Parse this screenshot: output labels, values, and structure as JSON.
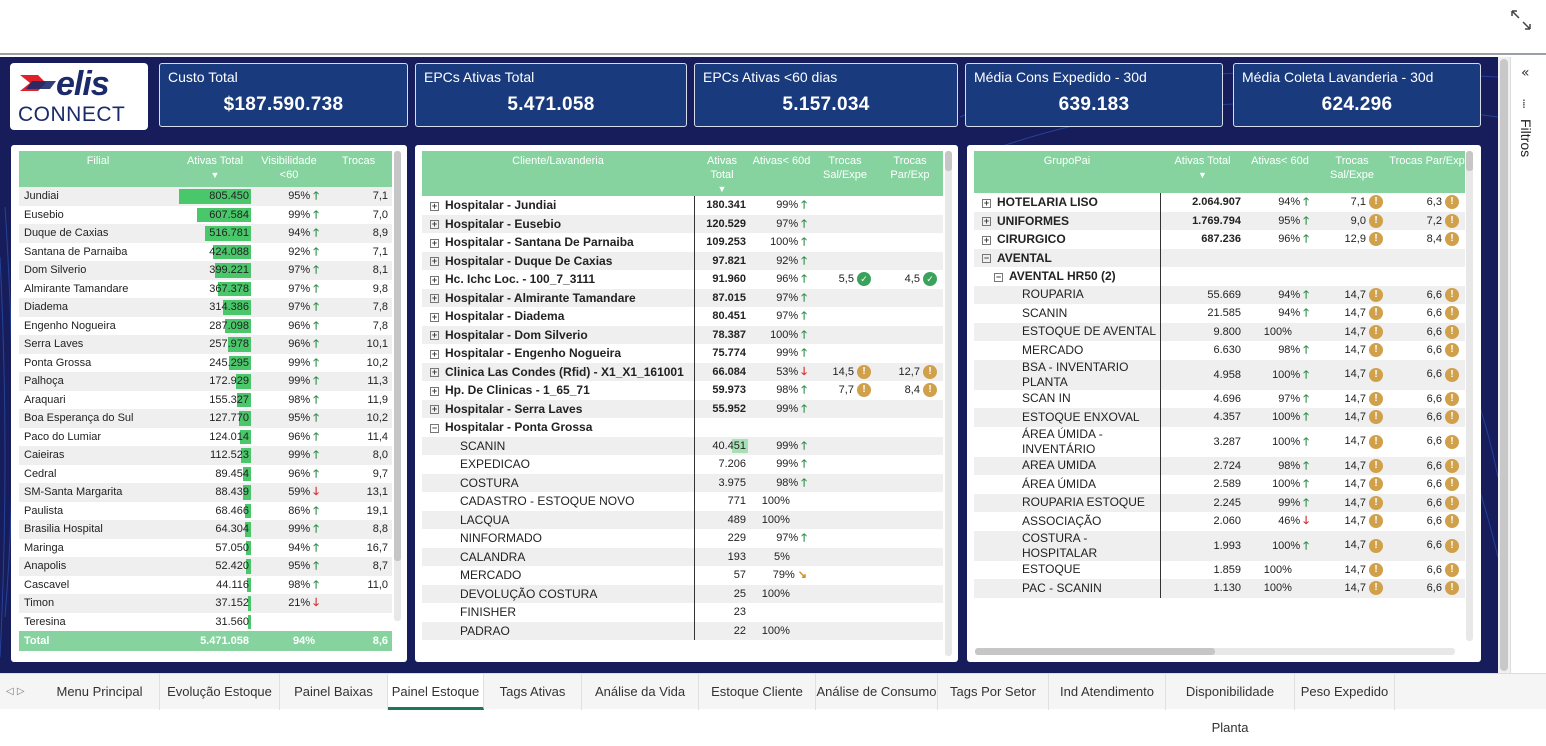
{
  "kpis": [
    {
      "title": "Custo Total",
      "value": "$187.590.738"
    },
    {
      "title": "EPCs Ativas Total",
      "value": "5.471.058"
    },
    {
      "title": "EPCs Ativas <60 dias",
      "value": "5.157.034"
    },
    {
      "title": "Média Cons Expedido - 30d",
      "value": "639.183"
    },
    {
      "title": "Média Coleta Lavanderia - 30d",
      "value": "624.296"
    }
  ],
  "logo": {
    "word": "elis",
    "sub": "CONNECT"
  },
  "filtros": "Filtros",
  "filial": {
    "headers": [
      "Filial",
      "Ativas Total",
      "Visibilidade <60",
      "Trocas"
    ],
    "rows": [
      [
        "Jundiai",
        "805.450",
        1.0,
        "95%",
        "up",
        "7,1"
      ],
      [
        "Eusebio",
        "607.584",
        0.75,
        "99%",
        "up",
        "7,0"
      ],
      [
        "Duque de Caxias",
        "516.781",
        0.64,
        "94%",
        "up",
        "8,9"
      ],
      [
        "Santana de Parnaiba",
        "424.088",
        0.53,
        "92%",
        "up",
        "7,1"
      ],
      [
        "Dom Silverio",
        "399.221",
        0.5,
        "97%",
        "up",
        "8,1"
      ],
      [
        "Almirante Tamandare",
        "367.378",
        0.46,
        "97%",
        "up",
        "9,8"
      ],
      [
        "Diadema",
        "314.386",
        0.39,
        "97%",
        "up",
        "7,8"
      ],
      [
        "Engenho Nogueira",
        "287.098",
        0.36,
        "96%",
        "up",
        "7,8"
      ],
      [
        "Serra Laves",
        "257.978",
        0.32,
        "96%",
        "up",
        "10,1"
      ],
      [
        "Ponta Grossa",
        "245.295",
        0.3,
        "99%",
        "up",
        "10,2"
      ],
      [
        "Palhoça",
        "172.929",
        0.21,
        "99%",
        "up",
        "11,3"
      ],
      [
        "Araquari",
        "155.327",
        0.19,
        "98%",
        "up",
        "11,9"
      ],
      [
        "Boa Esperança do Sul",
        "127.770",
        0.16,
        "95%",
        "up",
        "10,2"
      ],
      [
        "Paco do Lumiar",
        "124.014",
        0.15,
        "96%",
        "up",
        "11,4"
      ],
      [
        "Caieiras",
        "112.523",
        0.14,
        "99%",
        "up",
        "8,0"
      ],
      [
        "Cedral",
        "89.454",
        0.11,
        "96%",
        "up",
        "9,7"
      ],
      [
        "SM-Santa Margarita",
        "88.439",
        0.11,
        "59%",
        "dn",
        "13,1"
      ],
      [
        "Paulista",
        "68.466",
        0.085,
        "86%",
        "up",
        "19,1"
      ],
      [
        "Brasilia Hospital",
        "64.304",
        0.08,
        "99%",
        "up",
        "8,8"
      ],
      [
        "Maringa",
        "57.050",
        0.07,
        "94%",
        "up",
        "16,7"
      ],
      [
        "Anapolis",
        "52.420",
        0.065,
        "95%",
        "up",
        "8,7"
      ],
      [
        "Cascavel",
        "44.116",
        0.055,
        "98%",
        "up",
        "11,0"
      ],
      [
        "Timon",
        "37.152",
        0.046,
        "21%",
        "dn",
        ""
      ],
      [
        "Teresina",
        "31.560",
        0.04,
        "",
        "",
        ""
      ]
    ],
    "total": [
      "Total",
      "5.471.058",
      "94%",
      "8,6"
    ]
  },
  "cliente": {
    "headers": [
      "Cliente/Lavanderia",
      "Ativas Total",
      "Ativas< 60d",
      "Trocas Sal/Expe",
      "Trocas Par/Exp"
    ],
    "rows": [
      [
        "grp",
        "Hospitalar - Jundiai",
        "180.341",
        "99%",
        "up",
        "",
        "",
        ""
      ],
      [
        "grp",
        "Hospitalar - Eusebio",
        "120.529",
        "97%",
        "up",
        "",
        "",
        ""
      ],
      [
        "grp",
        "Hospitalar - Santana De Parnaiba",
        "109.253",
        "100%",
        "up",
        "",
        "",
        ""
      ],
      [
        "grp",
        "Hospitalar - Duque De Caxias",
        "97.821",
        "92%",
        "up",
        "",
        "",
        ""
      ],
      [
        "grp",
        "Hc. Ichc Loc. - 100_7_3111",
        "91.960",
        "96%",
        "up",
        "5,5",
        "4,5",
        "ok"
      ],
      [
        "grp",
        "Hospitalar - Almirante Tamandare",
        "87.015",
        "97%",
        "up",
        "",
        "",
        ""
      ],
      [
        "grp",
        "Hospitalar - Diadema",
        "80.451",
        "97%",
        "up",
        "",
        "",
        ""
      ],
      [
        "grp",
        "Hospitalar - Dom Silverio",
        "78.387",
        "100%",
        "up",
        "",
        "",
        ""
      ],
      [
        "grp",
        "Hospitalar - Engenho Nogueira",
        "75.774",
        "99%",
        "up",
        "",
        "",
        ""
      ],
      [
        "grp",
        "Clinica Las Condes (Rfid) - X1_X1_161001",
        "66.084",
        "53%",
        "dn",
        "14,5",
        "12,7",
        "warn"
      ],
      [
        "grp",
        "Hp. De Clinicas - 1_65_71",
        "59.973",
        "98%",
        "up",
        "7,7",
        "8,4",
        "warn"
      ],
      [
        "grp",
        "Hospitalar - Serra Laves",
        "55.952",
        "99%",
        "up",
        "",
        "",
        ""
      ],
      [
        "grpopen",
        "Hospitalar - Ponta Grossa",
        "",
        "",
        "",
        "",
        "",
        ""
      ],
      [
        "sub",
        "SCANIN",
        "40.451",
        "99%",
        "up",
        "",
        "",
        ""
      ],
      [
        "sub",
        "EXPEDICAO",
        "7.206",
        "99%",
        "up",
        "",
        "",
        ""
      ],
      [
        "sub",
        "COSTURA",
        "3.975",
        "98%",
        "up",
        "",
        "",
        ""
      ],
      [
        "sub",
        "CADASTRO - ESTOQUE NOVO",
        "771",
        "100%",
        "",
        "",
        "",
        ""
      ],
      [
        "sub",
        "LACQUA",
        "489",
        "100%",
        "",
        "",
        "",
        ""
      ],
      [
        "sub",
        "NINFORMADO",
        "229",
        "97%",
        "up",
        "",
        "",
        ""
      ],
      [
        "sub",
        "CALANDRA",
        "193",
        "5%",
        "",
        "",
        "",
        ""
      ],
      [
        "sub",
        "MERCADO",
        "57",
        "79%",
        "side",
        "",
        "",
        ""
      ],
      [
        "sub",
        "DEVOLUÇÃO COSTURA",
        "25",
        "100%",
        "",
        "",
        "",
        ""
      ],
      [
        "sub",
        "FINISHER",
        "23",
        "",
        "",
        "",
        "",
        ""
      ],
      [
        "sub",
        "PADRAO",
        "22",
        "100%",
        "",
        "",
        "",
        ""
      ]
    ]
  },
  "grupo": {
    "headers": [
      "GrupoPai",
      "Ativas Total",
      "Ativas< 60d",
      "Trocas Sal/Expe",
      "Trocas Par/Exp"
    ],
    "rows": [
      [
        "grp",
        "HOTELARIA LISO",
        "2.064.907",
        "94%",
        "up",
        "7,1",
        "6,3"
      ],
      [
        "grp",
        "UNIFORMES",
        "1.769.794",
        "95%",
        "up",
        "9,0",
        "7,2"
      ],
      [
        "grp",
        "CIRURGICO",
        "687.236",
        "96%",
        "up",
        "12,9",
        "8,4"
      ],
      [
        "grpopen",
        "AVENTAL",
        "",
        "",
        "",
        "",
        ""
      ],
      [
        "sub1",
        "AVENTAL HR50 (2)",
        "",
        "",
        "",
        "",
        ""
      ],
      [
        "sub2",
        "ROUPARIA",
        "55.669",
        "94%",
        "up",
        "14,7",
        "6,6"
      ],
      [
        "sub2",
        "SCANIN",
        "21.585",
        "94%",
        "up",
        "14,7",
        "6,6"
      ],
      [
        "sub2",
        "ESTOQUE DE AVENTAL",
        "9.800",
        "100%",
        "",
        "14,7",
        "6,6"
      ],
      [
        "sub2",
        "MERCADO",
        "6.630",
        "98%",
        "up",
        "14,7",
        "6,6"
      ],
      [
        "sub2",
        "BSA - INVENTARIO PLANTA",
        "4.958",
        "100%",
        "up",
        "14,7",
        "6,6"
      ],
      [
        "sub2",
        "SCAN IN",
        "4.696",
        "97%",
        "up",
        "14,7",
        "6,6"
      ],
      [
        "sub2",
        "ESTOQUE ENXOVAL",
        "4.357",
        "100%",
        "up",
        "14,7",
        "6,6"
      ],
      [
        "sub2",
        "ÁREA ÚMIDA - INVENTÁRIO",
        "3.287",
        "100%",
        "up",
        "14,7",
        "6,6"
      ],
      [
        "sub2",
        "AREA UMIDA",
        "2.724",
        "98%",
        "up",
        "14,7",
        "6,6"
      ],
      [
        "sub2",
        "ÁREA ÚMIDA",
        "2.589",
        "100%",
        "up",
        "14,7",
        "6,6"
      ],
      [
        "sub2",
        "ROUPARIA ESTOQUE",
        "2.245",
        "99%",
        "up",
        "14,7",
        "6,6"
      ],
      [
        "sub2",
        "ASSOCIAÇÃO",
        "2.060",
        "46%",
        "dn",
        "14,7",
        "6,6"
      ],
      [
        "sub2",
        "COSTURA - HOSPITALAR",
        "1.993",
        "100%",
        "up",
        "14,7",
        "6,6"
      ],
      [
        "sub2",
        "ESTOQUE",
        "1.859",
        "100%",
        "",
        "14,7",
        "6,6"
      ],
      [
        "sub2",
        "PAC - SCANIN",
        "1.130",
        "100%",
        "",
        "14,7",
        "6,6"
      ]
    ]
  },
  "tabs": [
    "Menu Principal",
    "Evolução Estoque",
    "Painel Baixas",
    "Painel Estoque",
    "Tags Ativas",
    "Análise da Vida",
    "Estoque Cliente",
    "Análise de Consumo",
    "Tags Por Setor",
    "Ind Atendimento",
    "Disponibilidade Planta",
    "Peso Expedido"
  ],
  "active_tab": "Painel Estoque",
  "colors": {
    "header": "#86d3a0",
    "kpi": "#193a7d",
    "bg": "#161d5a",
    "bar": "#4bc76b"
  }
}
